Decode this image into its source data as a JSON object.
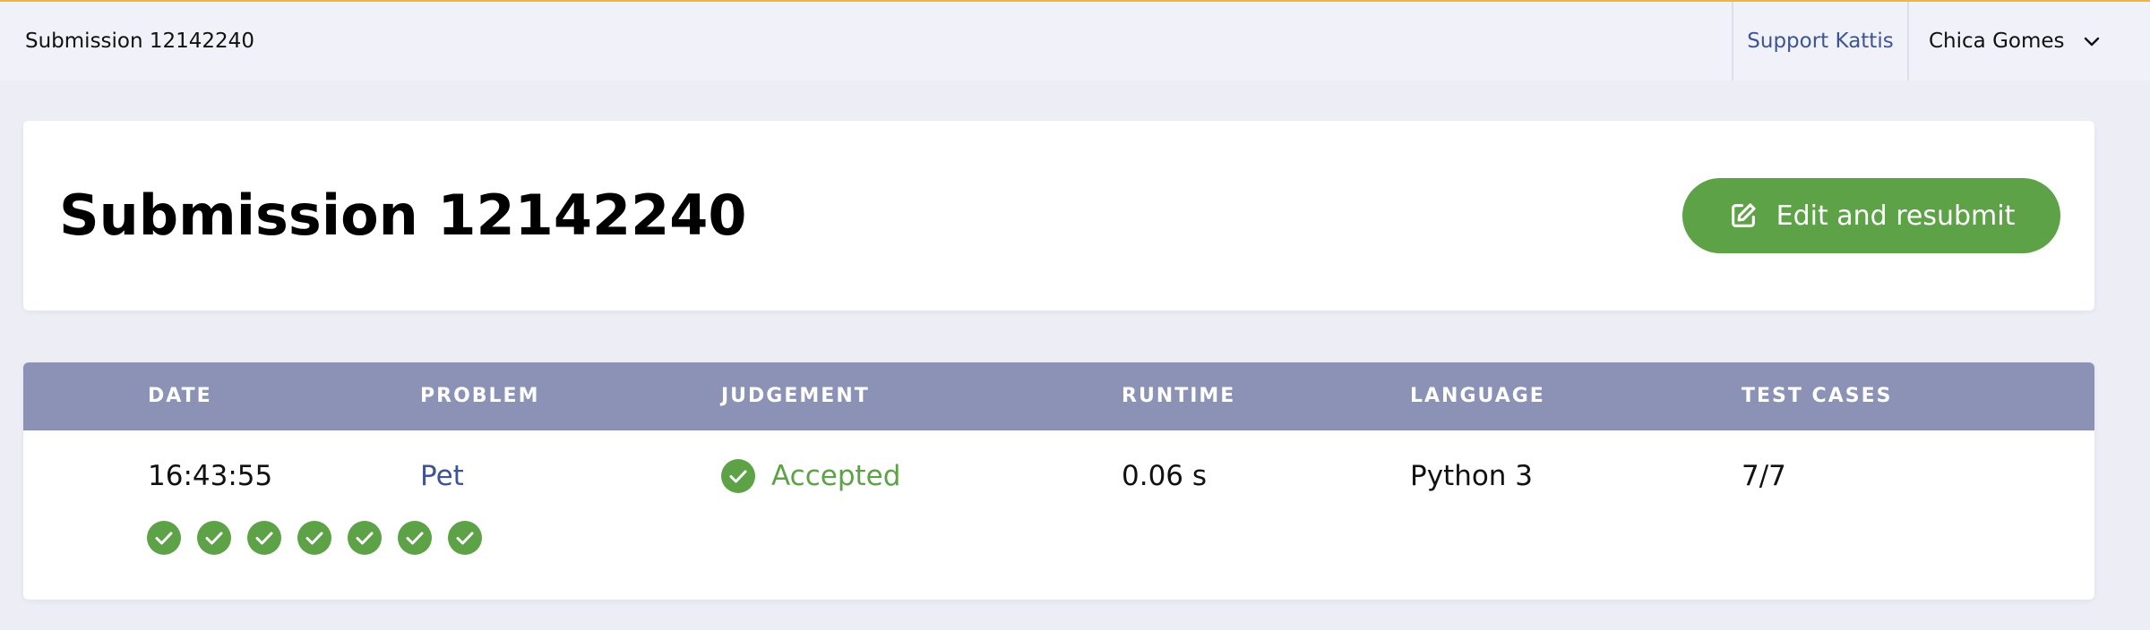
{
  "topbar": {
    "breadcrumb": "Submission 12142240",
    "support_link": "Support Kattis",
    "user_name": "Chica Gomes",
    "user_menu_icon": "chevron-down-icon"
  },
  "header": {
    "title": "Submission 12142240",
    "resubmit_label": "Edit and resubmit",
    "resubmit_icon": "edit-icon"
  },
  "table": {
    "columns": [
      "DATE",
      "PROBLEM",
      "JUDGEMENT",
      "RUNTIME",
      "LANGUAGE",
      "TEST CASES"
    ],
    "row": {
      "date": "16:43:55",
      "problem": "Pet",
      "judgement": "Accepted",
      "runtime": "0.06 s",
      "language": "Python 3",
      "test_cases": "7/7"
    },
    "test_case_results": [
      "passed",
      "passed",
      "passed",
      "passed",
      "passed",
      "passed",
      "passed"
    ]
  },
  "colors": {
    "accent_green": "#5da247",
    "link_blue": "#3d5495",
    "table_header_bg": "#8b92b5",
    "top_border": "#f0b640"
  }
}
